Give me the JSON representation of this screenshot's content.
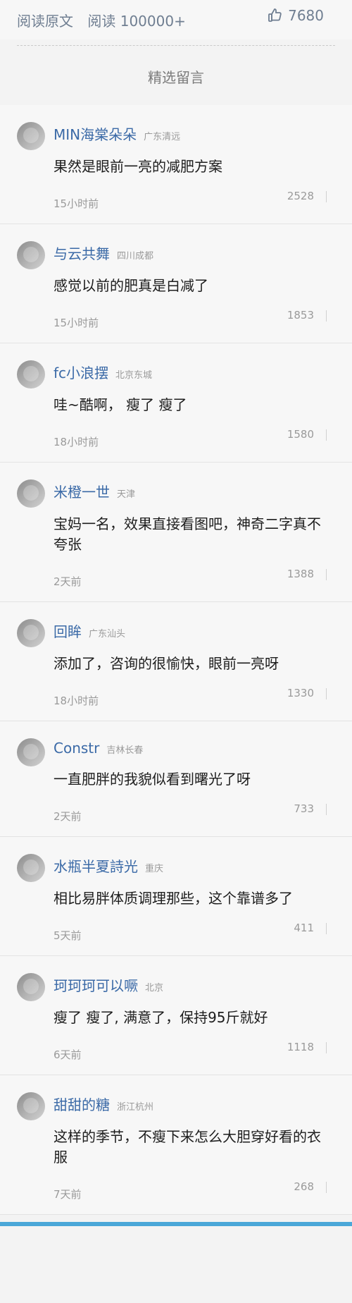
{
  "top": {
    "read_original": "阅读原文",
    "read_count": "阅读 100000+",
    "like_count": "7680",
    "like_icon": "thumb-up-icon"
  },
  "section": {
    "title": "精选留言"
  },
  "comments": [
    {
      "name": "MIN海棠朵朵",
      "location": "广东清远",
      "text": "果然是眼前一亮的减肥方案",
      "time": "15小时前",
      "likes": "2528"
    },
    {
      "name": "与云共舞",
      "location": "四川成都",
      "text": "感觉以前的肥真是白减了",
      "time": "15小时前",
      "likes": "1853"
    },
    {
      "name": "fc小浪摆",
      "location": "北京东城",
      "text": "哇~酷啊， 瘦了 瘦了",
      "time": "18小时前",
      "likes": "1580"
    },
    {
      "name": "米橙一世",
      "location": "天津",
      "text": "宝妈一名，效果直接看图吧，神奇二字真不夸张",
      "time": "2天前",
      "likes": "1388"
    },
    {
      "name": "回眸",
      "location": "广东汕头",
      "text": "添加了，咨询的很愉快，眼前一亮呀",
      "time": "18小时前",
      "likes": "1330"
    },
    {
      "name": "Constr",
      "location": "吉林长春",
      "text": "一直肥胖的我貌似看到曙光了呀",
      "time": "2天前",
      "likes": "733"
    },
    {
      "name": "水瓶半夏詩光",
      "location": "重庆",
      "text": "相比易胖体质调理那些，这个靠谱多了",
      "time": "5天前",
      "likes": "411"
    },
    {
      "name": "珂珂珂可以噘",
      "location": "北京",
      "text": "瘦了 瘦了, 满意了，保持95斤就好",
      "time": "6天前",
      "likes": "1118"
    },
    {
      "name": "甜甜的糖",
      "location": "浙江杭州",
      "text": "这样的季节，不瘦下来怎么大胆穿好看的衣服",
      "time": "7天前",
      "likes": "268"
    }
  ]
}
